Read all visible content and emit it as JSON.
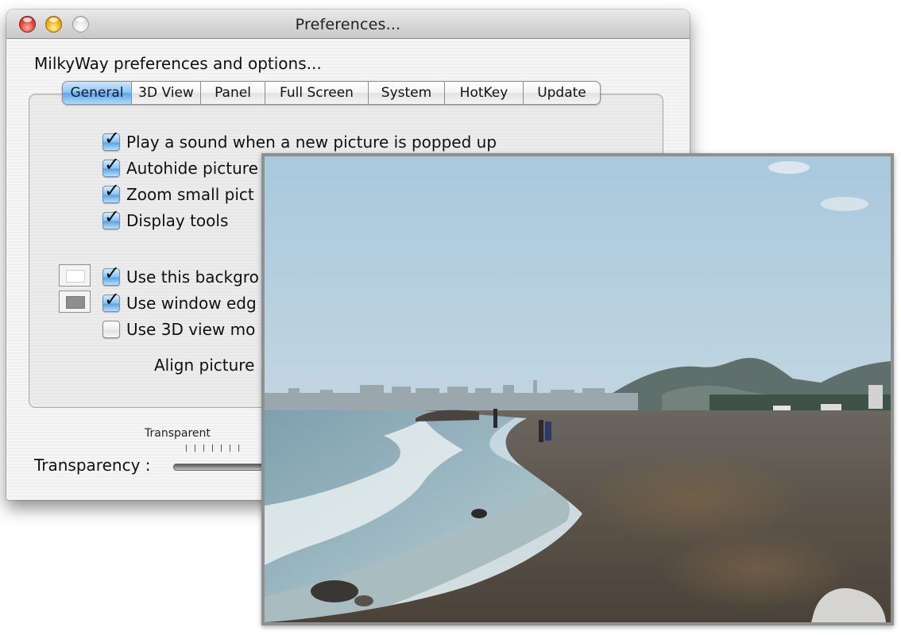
{
  "window": {
    "title": "Preferences...",
    "controls": [
      "close",
      "minimize",
      "zoom"
    ],
    "subtitle": "MilkyWay preferences and options..."
  },
  "tabs": [
    {
      "label": "General",
      "active": true
    },
    {
      "label": "3D View",
      "active": false
    },
    {
      "label": "Panel",
      "active": false
    },
    {
      "label": "Full Screen",
      "active": false
    },
    {
      "label": "System",
      "active": false
    },
    {
      "label": "HotKey",
      "active": false
    },
    {
      "label": "Update",
      "active": false
    }
  ],
  "general": {
    "options": [
      {
        "label": "Play a sound when a new picture is popped up",
        "checked": true
      },
      {
        "label": "Autohide picture",
        "checked": true
      },
      {
        "label": "Zoom small pict",
        "checked": true
      },
      {
        "label": "Display tools",
        "checked": true
      }
    ],
    "appearance_options": [
      {
        "label": "Use this backgro",
        "checked": true,
        "swatch_color": "#ffffff"
      },
      {
        "label": "Use window edg",
        "checked": true,
        "swatch_color": "#8e8e8e"
      },
      {
        "label": "Use 3D view mo",
        "checked": false
      }
    ],
    "align_label": "Align picture"
  },
  "transparency": {
    "label": "Transparency :",
    "scale_label": "Transparent",
    "tick_count": 7
  },
  "picture_popup": {
    "icon": "beach-photo",
    "description": "Photo of a pebble beach with waves, distant city skyline and hills under a pale blue sky"
  },
  "icons": {
    "check": "✓"
  }
}
